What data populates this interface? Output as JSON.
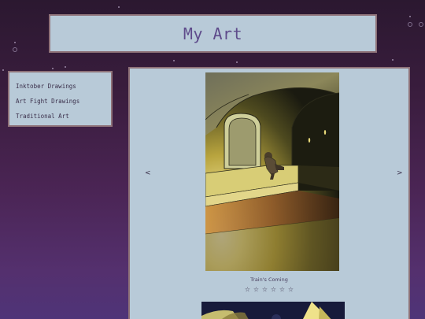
{
  "page": {
    "title": "My Art"
  },
  "sidebar": {
    "items": [
      {
        "label": "Inktober Drawings"
      },
      {
        "label": "Art Fight Drawings"
      },
      {
        "label": "Traditional Art"
      }
    ]
  },
  "gallery": {
    "prev_label": "<",
    "next_label": ">",
    "current_caption": "Train's Coming",
    "rating_stars": [
      "☆",
      "☆",
      "☆",
      "☆",
      "☆",
      "☆"
    ],
    "rating_value": 0,
    "rating_max": 6
  },
  "colors": {
    "panel_bg": "#b8cad8",
    "panel_border": "#8e7178",
    "title_text": "#5e4b8b"
  }
}
